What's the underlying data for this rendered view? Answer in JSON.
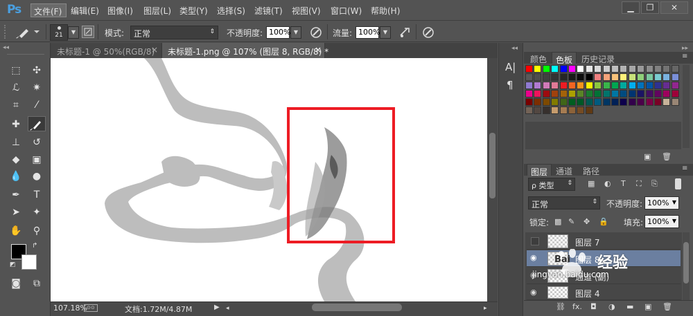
{
  "app": {
    "logo": "Ps"
  },
  "menu": [
    {
      "label": "文件(F)"
    },
    {
      "label": "编辑(E)"
    },
    {
      "label": "图像(I)"
    },
    {
      "label": "图层(L)"
    },
    {
      "label": "类型(Y)"
    },
    {
      "label": "选择(S)"
    },
    {
      "label": "滤镜(T)"
    },
    {
      "label": "视图(V)"
    },
    {
      "label": "窗口(W)"
    },
    {
      "label": "帮助(H)"
    }
  ],
  "window_controls": {
    "minimize": "▁",
    "restore": "❐",
    "close": "✕"
  },
  "options": {
    "brush_size": "21",
    "mode_label": "模式:",
    "mode_value": "正常",
    "opacity_label": "不透明度:",
    "opacity_value": "100%",
    "flow_label": "流量:",
    "flow_value": "100%"
  },
  "tabs": [
    {
      "label": "未标题-1 @ 50%(RGB/8)",
      "close": "×"
    },
    {
      "label": "未标题-1.png @ 107% (图层 8, RGB/8) *",
      "close": "×"
    }
  ],
  "status": {
    "zoom": "107.18%",
    "doc": "文档:1.72M/4.87M"
  },
  "mini_panel": {
    "char_icon": "A|",
    "para_icon": "¶"
  },
  "color_panel": {
    "tabs": [
      "颜色",
      "色板",
      "历史记录"
    ],
    "active_tab": "色板",
    "swatches": [
      "#ff0000",
      "#ffff00",
      "#00ff00",
      "#00ffff",
      "#0000ff",
      "#ff00ff",
      "#ffffff",
      "#e6e6e6",
      "#d9d9d9",
      "#cccccc",
      "#bfbfbf",
      "#b3b3b3",
      "#a6a6a6",
      "#999999",
      "#8c8c8c",
      "#808080",
      "#737373",
      "#666666",
      "#595959",
      "#4d4d4d",
      "#404040",
      "#333333",
      "#262626",
      "#1a1a1a",
      "#0d0d0d",
      "#000000",
      "#f08080",
      "#f5a37a",
      "#f7c27a",
      "#fff17a",
      "#c8e27a",
      "#8fd07a",
      "#7ac79e",
      "#7acbd0",
      "#7ab2e0",
      "#7a8fd8",
      "#8f7ad0",
      "#b07ad0",
      "#d07ab8",
      "#e07a96",
      "#ed1c24",
      "#f26522",
      "#f7941d",
      "#fff200",
      "#8dc63f",
      "#39b54a",
      "#00a651",
      "#00a99d",
      "#00aeef",
      "#0072bc",
      "#0054a6",
      "#2e3192",
      "#662d91",
      "#92278f",
      "#ec008c",
      "#ed145b",
      "#9e0b0f",
      "#a0410d",
      "#a3620a",
      "#aba000",
      "#598527",
      "#197b30",
      "#007236",
      "#00746b",
      "#0076a3",
      "#004b80",
      "#003471",
      "#1b1464",
      "#440e62",
      "#630460",
      "#9e005d",
      "#9e0039",
      "#790000",
      "#7b2e00",
      "#7d4900",
      "#827b00",
      "#406618",
      "#005e20",
      "#005826",
      "#005952",
      "#005b7f",
      "#003663",
      "#002157",
      "#0d004c",
      "#32004b",
      "#4b0049",
      "#7b0046",
      "#7a0026",
      "#c7b299",
      "#998675",
      "#736357",
      "#534741",
      "#37302d",
      "#c69c6d",
      "#a67c52",
      "#8c6239",
      "#754c24",
      "#603913"
    ]
  },
  "layers_panel": {
    "tabs": [
      "图层",
      "通道",
      "路径"
    ],
    "active_tab": "图层",
    "filter": "ρ 类型",
    "blend_mode": "正常",
    "opacity_label": "不透明度:",
    "opacity_value": "100%",
    "lock_label": "锁定:",
    "fill_label": "填充:",
    "fill_value": "100%",
    "layers": [
      {
        "name": "图层 7",
        "visible": false,
        "selected": false
      },
      {
        "name": "图层 8",
        "visible": true,
        "selected": true
      },
      {
        "name": "通道 (副)",
        "visible": true,
        "selected": false
      },
      {
        "name": "图层 4",
        "visible": true,
        "selected": false
      }
    ],
    "bottom_icons": [
      "link-icon",
      "fx-icon",
      "mask-icon",
      "adjustment-icon",
      "group-icon",
      "new-layer-icon",
      "trash-icon"
    ],
    "fx_label": "fx."
  },
  "watermark": {
    "brand": "Bai",
    "name": "经验",
    "url": "jingyan.baidu.com"
  },
  "colors": {
    "accent": "#ed1c24",
    "highlight_row": "#6b7fa0",
    "ps_blue": "#4a9fe0"
  }
}
